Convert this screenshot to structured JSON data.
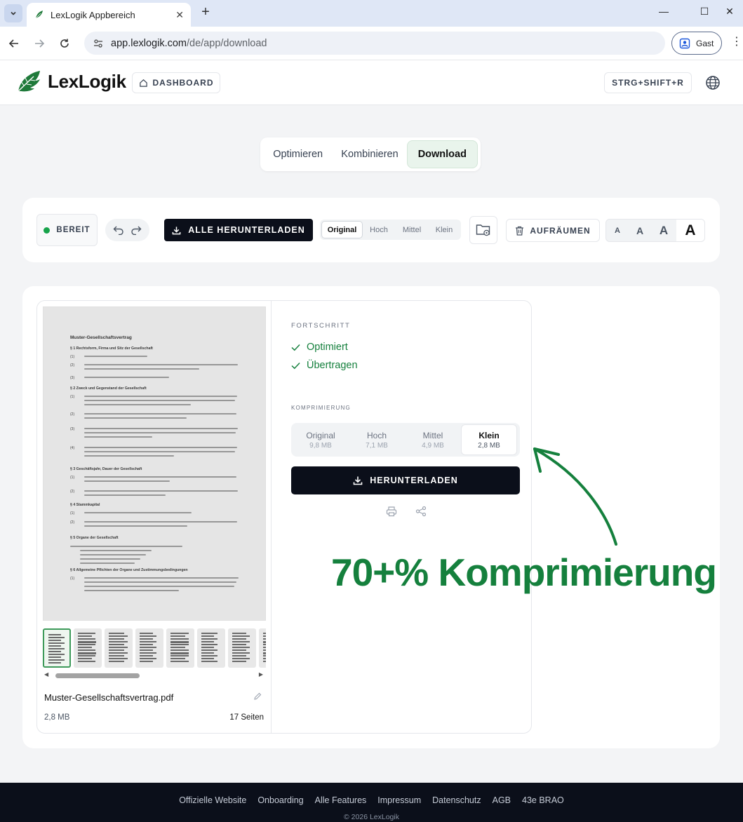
{
  "browser": {
    "tab_title": "LexLogik Appbereich",
    "tab_close": "✕",
    "new_tab": "+",
    "url_domain": "app.lexlogik.com",
    "url_path": "/de/app/download",
    "profile_label": "Gast",
    "window_minimize": "—",
    "window_maximize": "☐",
    "window_close": "✕"
  },
  "header": {
    "logo_text": "LexLogik",
    "dashboard_label": "DASHBOARD",
    "shortcut_label": "STRG+SHIFT+R"
  },
  "steps": {
    "items": [
      {
        "label": "Optimieren"
      },
      {
        "label": "Kombinieren"
      },
      {
        "label": "Download"
      }
    ],
    "active": "Download"
  },
  "toolbar": {
    "status_label": "BEREIT",
    "download_all_label": "ALLE HERUNTERLADEN",
    "quality_options": [
      "Original",
      "Hoch",
      "Mittel",
      "Klein"
    ],
    "quality_selected": "Original",
    "cleanup_label": "AUFRÄUMEN",
    "font_sizes": [
      "A",
      "A",
      "A",
      "A"
    ],
    "font_size_selected_index": 3
  },
  "file": {
    "preview": {
      "title": "Muster-Gesellschaftsvertrag",
      "sections": [
        "§ 1 Rechtsform, Firma und Sitz der Gesellschaft",
        "§ 2 Zweck und Gegenstand der Gesellschaft",
        "§ 3 Geschäftsjahr, Dauer der Gesellschaft",
        "§ 4 Stammkapital",
        "§ 5 Organe der Gesellschaft",
        "§ 6 Allgemeine Pflichten der Organe und Zustimmungsbedingungen"
      ],
      "para_numbers": [
        "(1)",
        "(2)",
        "(3)",
        "(1)",
        "(2)",
        "(3)",
        "(4)",
        "(1)",
        "(2)",
        "(1)",
        "(2)",
        "(1)"
      ]
    },
    "name": "Muster-Gesellschaftsvertrag.pdf",
    "size": "2,8 MB",
    "pages": "17 Seiten",
    "progress_label": "FORTSCHRITT",
    "progress_items": [
      "Optimiert",
      "Übertragen"
    ],
    "compression_label": "KOMPRIMIERUNG",
    "compression_options": [
      {
        "label": "Original",
        "size": "9,8 MB"
      },
      {
        "label": "Hoch",
        "size": "7,1 MB"
      },
      {
        "label": "Mittel",
        "size": "4,9 MB"
      },
      {
        "label": "Klein",
        "size": "2,8 MB"
      }
    ],
    "compression_selected": "Klein",
    "download_label": "HERUNTERLADEN"
  },
  "annotation": {
    "text": "70+% Komprimierung",
    "color": "#15803d"
  },
  "footer": {
    "links": [
      "Offizielle Website",
      "Onboarding",
      "Alle Features",
      "Impressum",
      "Datenschutz",
      "AGB",
      "43e BRAO"
    ],
    "copyright": "© 2026 LexLogik"
  },
  "colors": {
    "accent_green": "#15803d",
    "dark": "#0b0f1a",
    "status_dot": "#16a34a"
  }
}
